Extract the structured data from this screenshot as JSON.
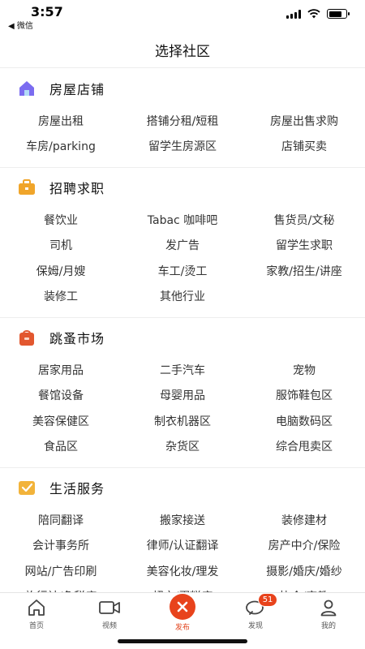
{
  "status_bar": {
    "time": "3:57",
    "back_label": "◀ 微信",
    "battery_level": 0.75
  },
  "header": {
    "title": "选择社区"
  },
  "sections": [
    {
      "title": "房屋店铺",
      "icon": "house-icon",
      "icon_color": "#7b6cf0",
      "items": [
        "房屋出租",
        "搭铺分租/短租",
        "房屋出售求购",
        "车房/parking",
        "留学生房源区",
        "店铺买卖"
      ]
    },
    {
      "title": "招聘求职",
      "icon": "briefcase-icon",
      "icon_color": "#f0a52a",
      "items": [
        "餐饮业",
        "Tabac 咖啡吧",
        "售货员/文秘",
        "司机",
        "发广告",
        "留学生求职",
        "保姆/月嫂",
        "车工/烫工",
        "家教/招生/讲座",
        "装修工",
        "其他行业"
      ]
    },
    {
      "title": "跳蚤市场",
      "icon": "bag-icon",
      "icon_color": "#e2572f",
      "items": [
        "居家用品",
        "二手汽车",
        "宠物",
        "餐馆设备",
        "母婴用品",
        "服饰鞋包区",
        "美容保健区",
        "制衣机器区",
        "电脑数码区",
        "食品区",
        "杂货区",
        "综合甩卖区"
      ]
    },
    {
      "title": "生活服务",
      "icon": "service-icon",
      "icon_color": "#f2b33a",
      "items": [
        "陪同翻译",
        "搬家接送",
        "装修建材",
        "会计事务所",
        "律师/认证翻译",
        "房产中介/保险",
        "网站/广告印刷",
        "美容化妆/理发",
        "摄影/婚庆/婚纱",
        "旅行社/免税店",
        "超市/蛋糕店",
        "协会/宗教"
      ]
    }
  ],
  "tabbar": {
    "tabs": [
      {
        "label": "首页",
        "icon": "home-icon"
      },
      {
        "label": "视频",
        "icon": "video-icon"
      },
      {
        "label": "发布",
        "icon": "publish-icon"
      },
      {
        "label": "发现",
        "icon": "discover-icon",
        "badge": "51"
      },
      {
        "label": "我的",
        "icon": "profile-icon"
      }
    ],
    "active_color": "#e2421b"
  }
}
